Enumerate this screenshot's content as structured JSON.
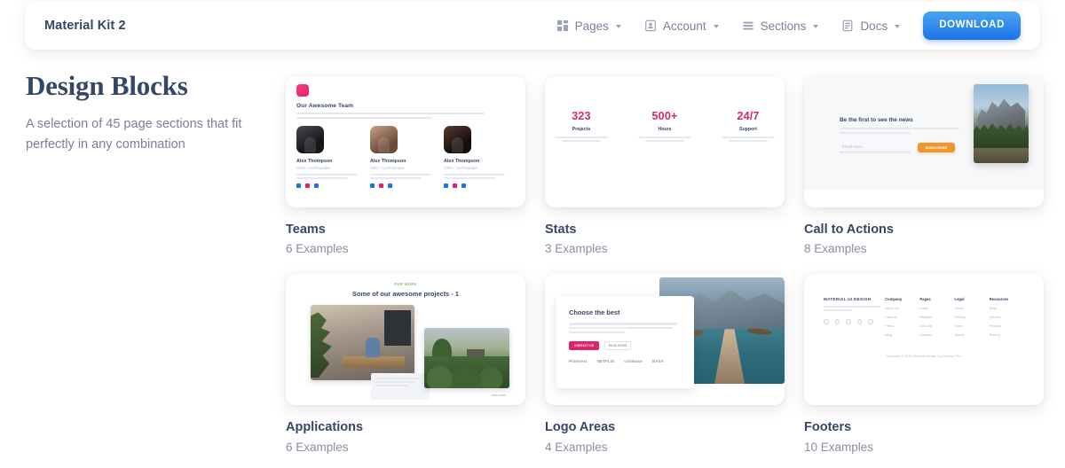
{
  "navbar": {
    "brand": "Material Kit 2",
    "items": [
      {
        "label": "Pages",
        "icon": "grid-icon"
      },
      {
        "label": "Account",
        "icon": "id-card-icon"
      },
      {
        "label": "Sections",
        "icon": "list-icon"
      },
      {
        "label": "Docs",
        "icon": "book-icon"
      }
    ],
    "download_label": "DOWNLOAD",
    "download_color": "#1A73E8"
  },
  "heading": {
    "title": "Design Blocks",
    "subtitle": "A selection of 45 page sections that fit perfectly in any combination"
  },
  "blocks": [
    {
      "title": "Teams",
      "count": "6 Examples"
    },
    {
      "title": "Stats",
      "count": "3 Examples"
    },
    {
      "title": "Call to Actions",
      "count": "8 Examples"
    },
    {
      "title": "Applications",
      "count": "6 Examples"
    },
    {
      "title": "Logo Areas",
      "count": "4 Examples"
    },
    {
      "title": "Footers",
      "count": "10 Examples"
    }
  ],
  "previews": {
    "teams": {
      "heading": "Our Awesome Team",
      "members": [
        {
          "name": "Alex Thompson",
          "role": "CEO / Co-Founder"
        },
        {
          "name": "Alex Thompson",
          "role": "CEO / Co-Founder"
        },
        {
          "name": "Alex Thompson",
          "role": "CEO / Co-Founder"
        }
      ]
    },
    "stats": {
      "items": [
        {
          "value": "323",
          "label": "Projects"
        },
        {
          "value": "500+",
          "label": "Hours"
        },
        {
          "value": "24/7",
          "label": "Support"
        }
      ],
      "accent_color": "#d6286b"
    },
    "cta": {
      "heading": "Be the first to see the news",
      "input_placeholder": "Email Here...",
      "button_label": "SUBSCRIBE",
      "button_color": "#f0952f"
    },
    "applications": {
      "eyebrow": "OUR WORK",
      "heading": "Some of our awesome projects - 1",
      "more_label": "read more"
    },
    "logo_areas": {
      "heading": "Choose the best",
      "primary_button": "CONTACT US",
      "secondary_button": "READ MORE",
      "logos": [
        "Pinterest",
        "NETFLIX",
        "coinbase",
        "NASA"
      ]
    },
    "footers": {
      "brand": "MATERIAL UI DESIGN",
      "columns": [
        {
          "heading": "Company",
          "links": [
            "About Us",
            "Careers",
            "Press",
            "Blog"
          ]
        },
        {
          "heading": "Pages",
          "links": [
            "Login",
            "Register",
            "Add List",
            "Contact"
          ]
        },
        {
          "heading": "Legal",
          "links": [
            "Terms",
            "Privacy",
            "Team",
            "About"
          ]
        },
        {
          "heading": "Resources",
          "links": [
            "Blog",
            "Service",
            "Product",
            "Pricing"
          ]
        }
      ],
      "copyright": "Copyright © 2021 Material Design by Creative Tim."
    }
  }
}
